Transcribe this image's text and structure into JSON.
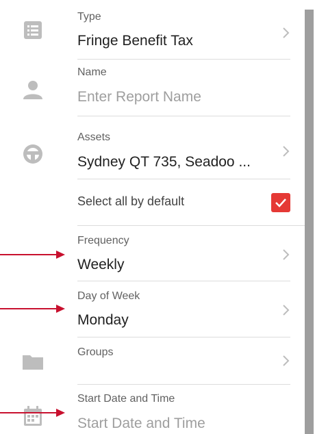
{
  "form": {
    "type": {
      "label": "Type",
      "value": "Fringe Benefit Tax"
    },
    "name": {
      "label": "Name",
      "placeholder": "Enter Report Name"
    },
    "assets": {
      "label": "Assets",
      "value": "Sydney QT 735, Seadoo ..."
    },
    "select_all": {
      "label": "Select all by default",
      "checked": true
    },
    "frequency": {
      "label": "Frequency",
      "value": "Weekly"
    },
    "day_of_week": {
      "label": "Day of Week",
      "value": "Monday"
    },
    "groups": {
      "label": "Groups",
      "value": ""
    },
    "start": {
      "label": "Start Date and Time",
      "placeholder": "Start Date and Time"
    }
  },
  "icons": {
    "type": "list-icon",
    "name": "person-icon",
    "assets": "steering-wheel-icon",
    "groups": "folder-icon",
    "start": "calendar-icon",
    "chevron": "chevron-right-icon",
    "checkbox": "checkbox-checked-icon"
  },
  "colors": {
    "accent": "#e53935",
    "annotation_arrow": "#c8102e",
    "icon_gray": "#bdbdbd",
    "scrollbar": "#9e9e9e"
  }
}
